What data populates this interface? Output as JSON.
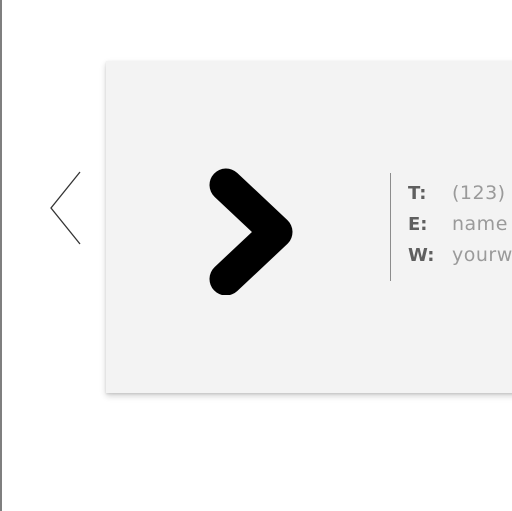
{
  "carousel": {
    "prev_icon": "chevron-left-icon"
  },
  "card": {
    "logo_icon": "chevron-right-icon",
    "contact": [
      {
        "label": "T:",
        "value": "(123)"
      },
      {
        "label": "E:",
        "value": "name"
      },
      {
        "label": "W:",
        "value": "yourw"
      }
    ]
  },
  "colors": {
    "page_background": "#ffffff",
    "card_background": "#f3f3f3",
    "logo": "#000000",
    "label_text": "#5f5f5f",
    "value_text": "#9a9a9a",
    "divider": "#8c8c8c"
  }
}
